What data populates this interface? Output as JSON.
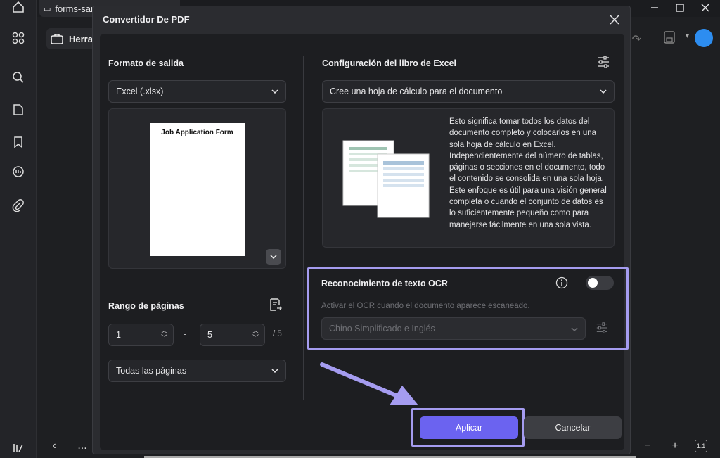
{
  "app": {
    "tab_title": "forms-san",
    "toolbar_label": "Herra"
  },
  "dialog": {
    "title": "Convertidor De PDF",
    "output": {
      "title": "Formato de salida",
      "format_value": "Excel (.xlsx)",
      "preview_page_title": "Job Application Form"
    },
    "pages": {
      "title": "Rango de páginas",
      "from": "1",
      "separator": "-",
      "to": "5",
      "total": "/ 5",
      "range_value": "Todas las páginas"
    },
    "excel": {
      "title": "Configuración del libro de Excel",
      "mode_value": "Cree una hoja de cálculo para el documento",
      "description": "Esto significa tomar todos los datos del documento completo y colocarlos en una sola hoja de cálculo en Excel. Independientemente del número de tablas, páginas o secciones en el documento, todo el contenido se consolida en una sola hoja. Este enfoque es útil para una visión general completa o cuando el conjunto de datos es lo suficientemente pequeño como para manejarse fácilmente en una sola vista."
    },
    "ocr": {
      "title": "Reconocimiento de texto OCR",
      "enabled": false,
      "hint": "Activar el OCR cuando el documento aparece escaneado.",
      "language_value": "Chino Simplificado e Inglés"
    },
    "buttons": {
      "apply": "Aplicar",
      "cancel": "Cancelar"
    }
  },
  "bottombar": {
    "zoom_fit_label": "1:1",
    "more_label": "..."
  },
  "colors": {
    "accent": "#6b63f0",
    "highlight": "#a59cf0",
    "background": "#1e1f22"
  }
}
